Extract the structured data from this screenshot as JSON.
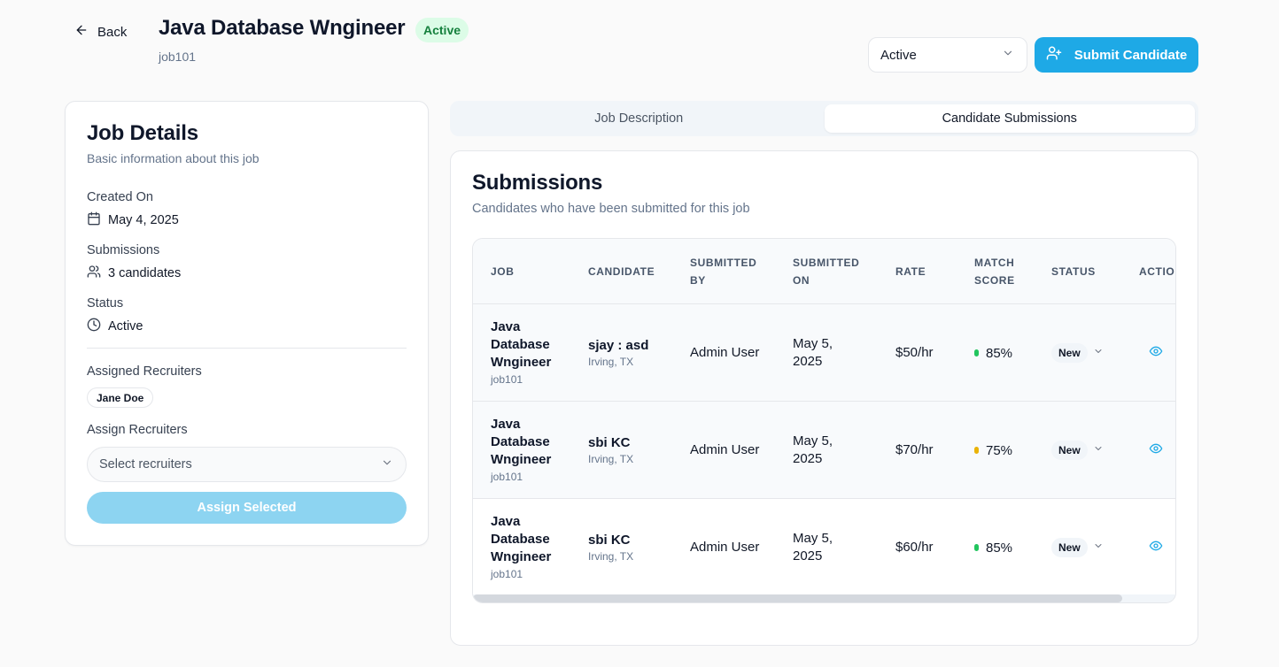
{
  "header": {
    "back_label": "Back",
    "title": "Java Database Wngineer",
    "badge": "Active",
    "job_code": "job101",
    "status_select_value": "Active",
    "submit_label": "Submit Candidate"
  },
  "details": {
    "title": "Job Details",
    "subtitle": "Basic information about this job",
    "created_label": "Created On",
    "created_value": "May 4, 2025",
    "submissions_label": "Submissions",
    "submissions_value": "3 candidates",
    "status_label": "Status",
    "status_value": "Active",
    "assigned_label": "Assigned Recruiters",
    "assigned": [
      "Jane Doe"
    ],
    "assign_label": "Assign Recruiters",
    "assign_placeholder": "Select recruiters",
    "assign_button": "Assign Selected"
  },
  "tabs": [
    {
      "label": "Job Description",
      "active": false
    },
    {
      "label": "Candidate Submissions",
      "active": true
    }
  ],
  "submissions": {
    "title": "Submissions",
    "subtitle": "Candidates who have been submitted for this job",
    "columns": [
      "JOB",
      "CANDIDATE",
      "SUBMITTED\nBY",
      "SUBMITTED\nON",
      "RATE",
      "MATCH\nSCORE",
      "STATUS",
      "ACTIO"
    ],
    "rows": [
      {
        "job_title": "Java Database Wngineer",
        "job_code": "job101",
        "candidate": "sjay : asd",
        "location": "Irving, TX",
        "submitted_by": "Admin User",
        "submitted_on": "May 5, 2025",
        "rate": "$50/hr",
        "score": "85%",
        "score_color": "#22c55e",
        "status": "New"
      },
      {
        "job_title": "Java Database Wngineer",
        "job_code": "job101",
        "candidate": "sbi KC",
        "location": "Irving, TX",
        "submitted_by": "Admin User",
        "submitted_on": "May 5, 2025",
        "rate": "$70/hr",
        "score": "75%",
        "score_color": "#eab308",
        "status": "New"
      },
      {
        "job_title": "Java Database Wngineer",
        "job_code": "job101",
        "candidate": "sbi KC",
        "location": "Irving, TX",
        "submitted_by": "Admin User",
        "submitted_on": "May 5, 2025",
        "rate": "$60/hr",
        "score": "85%",
        "score_color": "#22c55e",
        "status": "New"
      }
    ]
  },
  "colors": {
    "accent": "#1ea9e6",
    "accent_disabled": "#8dd4f1",
    "badge_bg": "#dcfce7",
    "badge_text": "#15803d",
    "view_icon": "#1ea9e6"
  }
}
